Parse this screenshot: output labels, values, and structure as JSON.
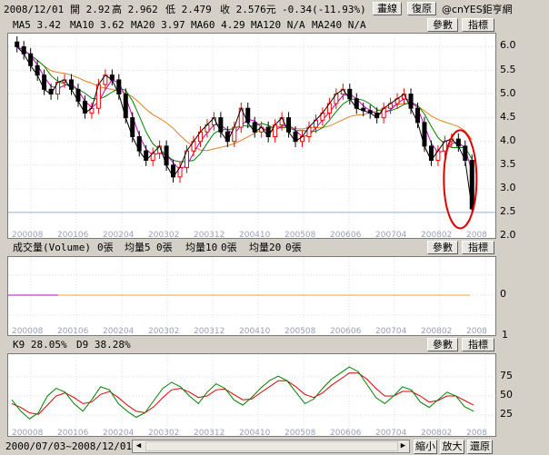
{
  "quote": {
    "date": "2008/12/01",
    "open": "開 2.92",
    "high": "高 2.962",
    "low": "低 2.479",
    "close": "收 2.576元",
    "change": "-0.34(-11.93%)",
    "draw_button": "畫線",
    "restore_button": "復原",
    "brand": "@cnYES鉅亨網"
  },
  "ma_line": {
    "ma5": "MA5 3.42",
    "ma10": "MA10 3.62",
    "ma20": "MA20 3.97",
    "ma60": "MA60 4.29",
    "ma120": "MA120 N/A",
    "ma240": "MA240 N/A"
  },
  "buttons": {
    "params": "參數",
    "indicator": "指標"
  },
  "price_axis": [
    "6.0",
    "5.5",
    "5.0",
    "4.5",
    "4.0",
    "3.5",
    "3.0",
    "2.5",
    "2.0"
  ],
  "x_dates": [
    "200008",
    "200106",
    "200204",
    "200302",
    "200312",
    "200410",
    "200508",
    "200606",
    "200704",
    "200802",
    "2008"
  ],
  "volume": {
    "label": "成交量(Volume)",
    "v0": "0張",
    "avg5": "均量5",
    "avg5_val": "0張",
    "avg10": "均量10",
    "avg10_val": "0張",
    "avg20": "均量20",
    "avg20_val": "0張",
    "axis_zero": "0",
    "axis_bottom": "1"
  },
  "kd": {
    "k": "K9 28.05%",
    "d": "D9 38.28%",
    "axis": [
      "75",
      "50",
      "25"
    ]
  },
  "footer": {
    "range": "2000/07/03~2008/12/01",
    "zoom_out": "縮小",
    "zoom_in": "放大",
    "restore": "還原"
  },
  "chart_data": {
    "type": "candlestick",
    "price_range": [
      2.0,
      6.2
    ],
    "close_series": [
      6.0,
      5.85,
      5.6,
      5.4,
      5.1,
      5.0,
      5.25,
      5.3,
      5.1,
      4.85,
      4.6,
      4.7,
      5.2,
      5.4,
      5.3,
      5.0,
      4.5,
      4.1,
      3.8,
      3.6,
      3.75,
      3.9,
      3.5,
      3.25,
      3.45,
      3.8,
      4.0,
      4.2,
      4.35,
      4.5,
      4.2,
      4.0,
      4.3,
      4.7,
      4.4,
      4.2,
      4.3,
      4.1,
      4.35,
      4.5,
      4.2,
      4.0,
      4.1,
      4.3,
      4.45,
      4.6,
      4.8,
      5.0,
      5.1,
      4.9,
      4.7,
      4.65,
      4.6,
      4.5,
      4.7,
      4.8,
      4.9,
      5.0,
      4.7,
      4.4,
      3.9,
      3.6,
      3.8,
      4.0,
      4.05,
      3.9,
      3.6,
      2.576
    ],
    "ma_colors": {
      "ma5": "#000000",
      "ma10": "#c000c0",
      "ma20": "#008000",
      "ma60": "#e08020"
    },
    "up_color": "#ff0000",
    "down_color": "#000000",
    "highlight_color": "#e00000",
    "k_series": [
      45,
      30,
      20,
      28,
      50,
      60,
      55,
      40,
      30,
      45,
      62,
      58,
      40,
      30,
      22,
      28,
      44,
      60,
      68,
      62,
      50,
      40,
      55,
      66,
      60,
      45,
      38,
      48,
      60,
      70,
      76,
      70,
      55,
      40,
      46,
      60,
      72,
      80,
      88,
      82,
      65,
      48,
      40,
      50,
      62,
      58,
      42,
      35,
      45,
      55,
      50,
      36,
      30
    ],
    "d_series": [
      40,
      35,
      28,
      26,
      38,
      50,
      54,
      48,
      40,
      42,
      52,
      56,
      48,
      38,
      30,
      28,
      36,
      48,
      58,
      60,
      55,
      48,
      50,
      58,
      59,
      52,
      45,
      46,
      54,
      62,
      70,
      70,
      62,
      52,
      48,
      54,
      64,
      72,
      80,
      80,
      72,
      60,
      50,
      50,
      56,
      56,
      50,
      42,
      44,
      50,
      50,
      44,
      38
    ]
  }
}
